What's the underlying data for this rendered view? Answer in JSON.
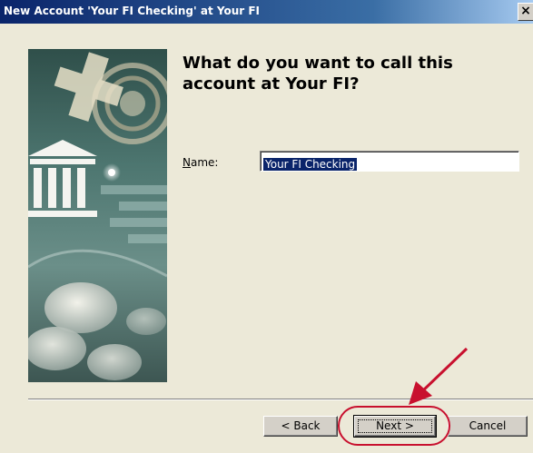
{
  "window": {
    "title": "New Account 'Your FI Checking' at Your FI",
    "close_label": "×"
  },
  "main": {
    "heading": "What do you want to call this account at Your FI?",
    "name_label_accel": "N",
    "name_label_rest": "ame:",
    "name_value": "Your FI Checking"
  },
  "buttons": {
    "back": "< Back",
    "next": "Next >",
    "cancel": "Cancel"
  },
  "annotation": {
    "color": "#c8102e"
  },
  "colors": {
    "dialog_bg": "#ece9d8",
    "titlebar": "#0a246a",
    "selection": "#0a246a"
  }
}
